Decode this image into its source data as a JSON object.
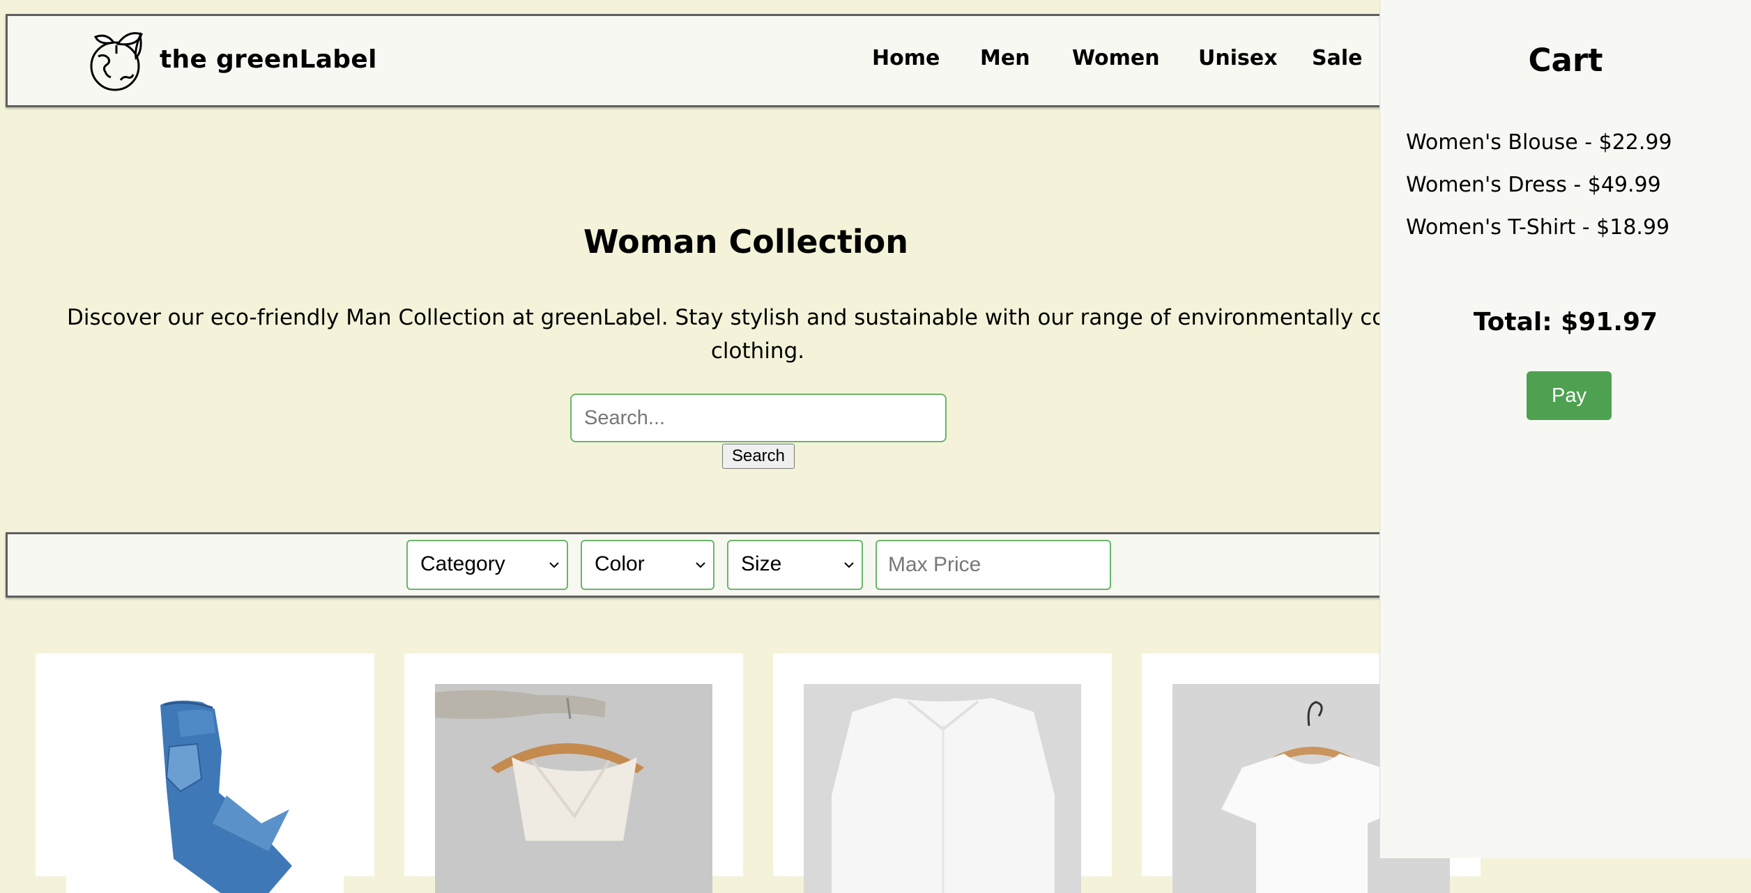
{
  "header": {
    "brand": "the greenLabel",
    "nav": [
      "Home",
      "Men",
      "Women",
      "Unisex",
      "Sale"
    ]
  },
  "hero": {
    "title": "Woman Collection",
    "description_line1": "Discover our eco-friendly Man Collection at greenLabel. Stay stylish and sustainable with our range of environmentally conscious wo",
    "description_line2": "clothing.",
    "search_placeholder": "Search...",
    "search_button": "Search"
  },
  "filters": {
    "category": "Category",
    "color": "Color",
    "size": "Size",
    "max_price_placeholder": "Max Price"
  },
  "products": [
    {
      "image": "blue-jeans"
    },
    {
      "image": "white-tank-top-on-hanger"
    },
    {
      "image": "white-button-shirt"
    },
    {
      "image": "white-tshirt-on-hanger"
    }
  ],
  "cart": {
    "title": "Cart",
    "items": [
      "Women's Blouse - $22.99",
      "Women's Dress - $49.99",
      "Women's T-Shirt - $18.99"
    ],
    "total": "Total: $91.97",
    "pay_button": "Pay"
  },
  "colors": {
    "page_bg": "#f4f3d9",
    "panel_bg": "#f7f8f2",
    "accent_green": "#4ea150",
    "input_border": "#6bb56a"
  }
}
